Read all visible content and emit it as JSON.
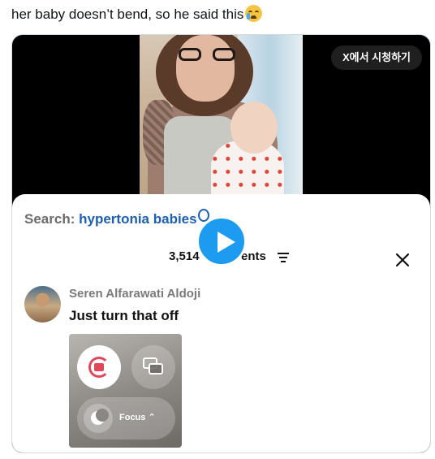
{
  "tweet": {
    "text": "her baby doesn’t bend, so he said this",
    "emoji": "loudly-crying-face"
  },
  "video": {
    "watch_on_x_label": "X에서 시청하기"
  },
  "overlay": {
    "search_prefix": "Search:",
    "search_term": "hypertonia babies",
    "comments_count": "3,514",
    "comments_suffix": "ents",
    "comment_author": "Seren Alfarawati Aldoji",
    "comment_text": "Just turn that off",
    "control_center": {
      "focus_label": "Focus ⌃"
    }
  },
  "colors": {
    "play_button": "#1d9bf0",
    "search_term": "#1d5fb0",
    "lock_icon": "#e0485a"
  }
}
